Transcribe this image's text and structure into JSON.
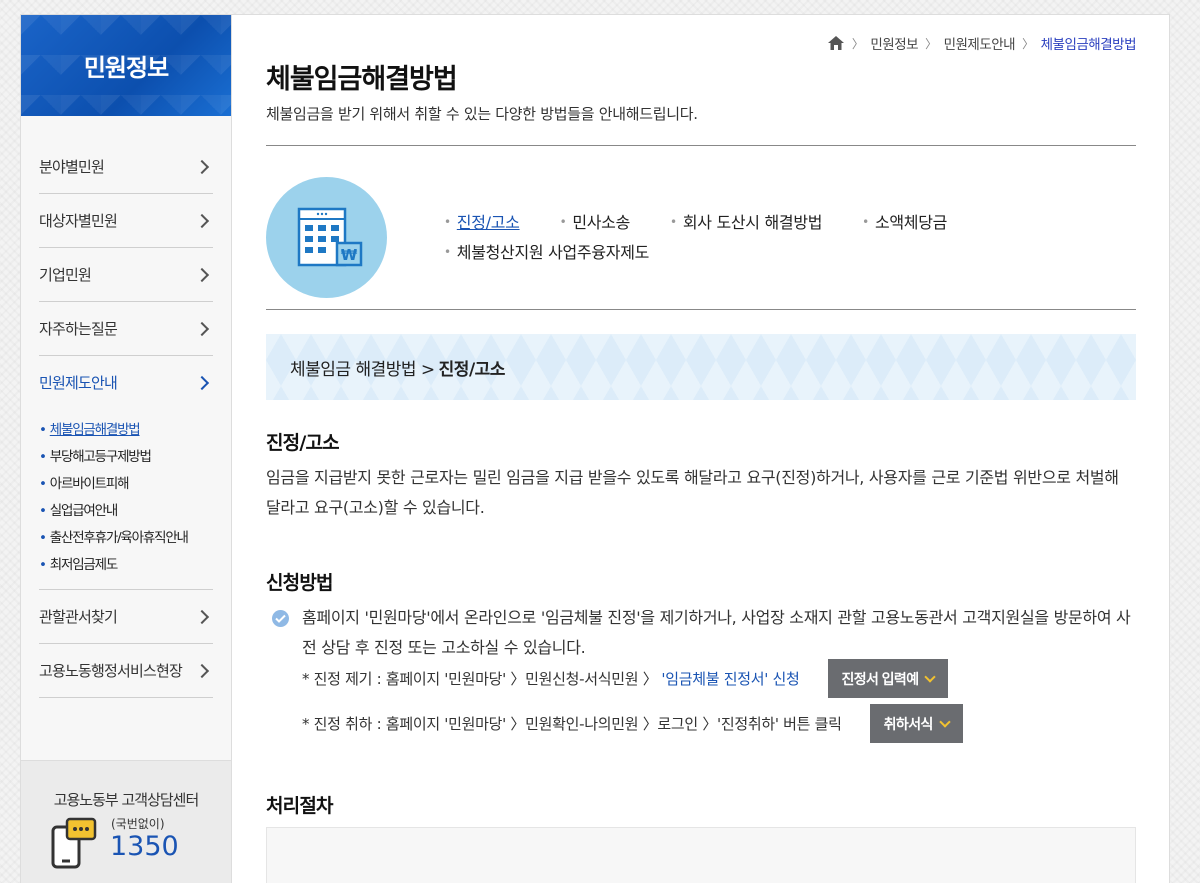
{
  "sidebar": {
    "title": "민원정보",
    "items": [
      {
        "label": "분야별민원"
      },
      {
        "label": "대상자별민원"
      },
      {
        "label": "기업민원"
      },
      {
        "label": "자주하는질문"
      },
      {
        "label": "민원제도안내"
      },
      {
        "label": "관할관서찾기"
      },
      {
        "label": "고용노동행정서비스현장"
      }
    ],
    "sub_items": [
      {
        "label": "체불임금해결방법"
      },
      {
        "label": "부당해고등구제방법"
      },
      {
        "label": "아르바이트피해"
      },
      {
        "label": "실업급여안내"
      },
      {
        "label": "출산전후휴가/육아휴직안내"
      },
      {
        "label": "최저임금제도"
      }
    ],
    "call_center": {
      "title": "고용노동부 고객상담센터",
      "sub": "(국번없이)",
      "number": "1350"
    }
  },
  "breadcrumb": [
    "민원정보",
    "민원제도안내",
    "체불임금해결방법"
  ],
  "page": {
    "title": "체불임금해결방법",
    "description": "체불임금을 받기 위해서 취할 수 있는 다양한 방법들을 안내해드립니다."
  },
  "quick_links": [
    {
      "label": "진정/고소"
    },
    {
      "label": "민사소송"
    },
    {
      "label": "회사 도산시 해결방법"
    },
    {
      "label": "소액체당금"
    },
    {
      "label": "체불청산지원 사업주융자제도"
    }
  ],
  "band": {
    "prefix": "체불임금 해결방법 > ",
    "current": "진정/고소"
  },
  "section1": {
    "title": "진정/고소",
    "text": "임금을 지급받지 못한 근로자는 밀린 임금을 지급 받을수 있도록 해달라고 요구(진정)하거나, 사용자를 근로 기준법 위반으로 처벌해 달라고 요구(고소)할 수 있습니다."
  },
  "section2": {
    "title": "신청방법",
    "check_text": "홈페이지 '민원마당'에서 온라인으로 '임금체불 진정'을 제기하거나, 사업장 소재지 관할 고용노동관서 고객지원실을 방문하여 사전 상담 후 진정 또는 고소하실 수 있습니다.",
    "note1_text": "* 진정 제기 : 홈페이지 '민원마당' 〉민원신청-서식민원 〉",
    "note1_link": "'임금체불 진정서' 신청",
    "note1_button": "진정서 입력예",
    "note2_text": "* 진정 취하 : 홈페이지 '민원마당' 〉민원확인-나의민원 〉로그인 〉'진정취하' 버튼 클릭",
    "note2_button": "취하서식"
  },
  "section3": {
    "title": "처리절차"
  },
  "colors": {
    "brand_blue": "#1a54b3",
    "button_gray": "#6a6c70",
    "band_blue": "#dcecf9",
    "circle_blue": "#9cd2ec"
  }
}
